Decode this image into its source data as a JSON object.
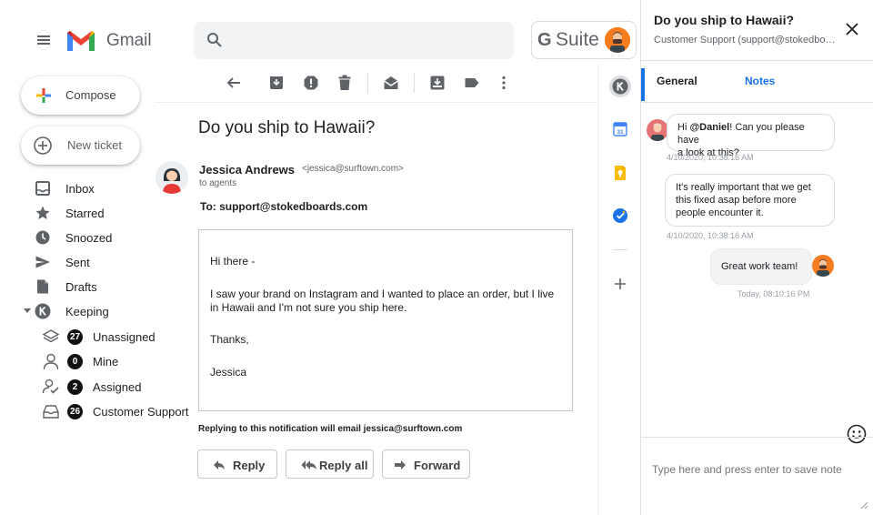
{
  "header": {
    "app_name": "Gmail",
    "search_placeholder": "",
    "gsuite_g": "G",
    "gsuite_text": "Suite"
  },
  "sidebar": {
    "compose_label": "Compose",
    "new_ticket_label": "New ticket",
    "nav": [
      {
        "label": "Inbox"
      },
      {
        "label": "Starred"
      },
      {
        "label": "Snoozed"
      },
      {
        "label": "Sent"
      },
      {
        "label": "Drafts"
      },
      {
        "label": "Keeping"
      }
    ],
    "keeping_sub": [
      {
        "label": "Unassigned",
        "count": "27"
      },
      {
        "label": "Mine",
        "count": "0"
      },
      {
        "label": "Assigned",
        "count": "2"
      },
      {
        "label": "Customer Support",
        "count": "26"
      }
    ]
  },
  "message": {
    "subject": "Do you ship to Hawaii?",
    "sender_name": "Jessica Andrews",
    "sender_email": "<jessica@surftown.com>",
    "recipients_note": "to agents",
    "to_line": "To: support@stokedboards.com",
    "body": {
      "greeting": "Hi there -",
      "paragraph_1": "I saw your brand on Instagram and I wanted to place an order, but I live",
      "paragraph_2": "in Hawaii and I'm not sure you ship here.",
      "closing": "Thanks,",
      "signature": "Jessica"
    },
    "reply_note": "Replying to this notification will email jessica@surftown.com",
    "actions": {
      "reply": "Reply",
      "reply_all": "Reply all",
      "forward": "Forward"
    }
  },
  "panel": {
    "title": "Do you ship to Hawaii?",
    "subtitle": "Customer Support (support@stokedboards.com)",
    "tabs": {
      "general": "General",
      "notes": "Notes"
    },
    "notes": [
      {
        "prefix": "Hi ",
        "mention": "@Daniel",
        "line_1_rest": "! Can you please have",
        "line_2": "a look at this?",
        "time": "4/10/2020, 10:38:16 AM"
      },
      {
        "line_1": "It's really important that we get",
        "line_2": "this fixed asap before more",
        "line_3": "people encounter it.",
        "time": "4/10/2020, 10:38:16 AM"
      },
      {
        "text": "Great work team!",
        "time": "Today, 08:10:16 PM"
      }
    ],
    "input_placeholder": "Type here and press enter to save note"
  },
  "colors": {
    "accent_blue": "#1a73e8",
    "gmail_red": "#ea4335",
    "avatar_orange": "#f57c1f",
    "badge_black": "#111111"
  }
}
